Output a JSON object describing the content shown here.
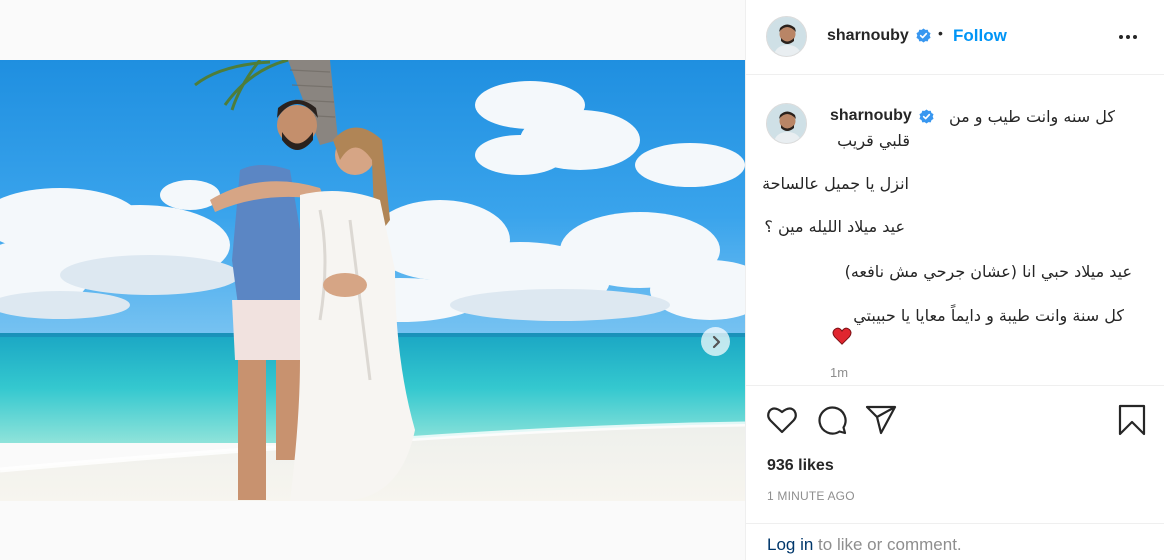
{
  "post": {
    "username": "sharnouby",
    "header_separator": "•",
    "follow_label": "Follow",
    "caption_lines": [
      "كل سنه وانت طيب و من",
      "قلبي قريب",
      "انزل يا جميل عالساحة",
      "عيد ميلاد الليله مين ؟",
      "عيد ميلاد حبي انا (عشان جرحي مش نافعه)",
      "كل سنة وانت طيبة و دايماً معايا يا حبيبتي"
    ],
    "caption_time": "1m",
    "likes": "936 likes",
    "post_time": "1 MINUTE AGO"
  },
  "footer": {
    "login_link": "Log in",
    "login_suffix": " to like or comment."
  },
  "colors": {
    "accent": "#0095f6",
    "verified": "#3897f0",
    "heart": "#e0262f"
  },
  "icons": [
    "verified-badge-icon",
    "more-options-icon",
    "heart-icon",
    "comment-icon",
    "share-icon",
    "bookmark-icon",
    "chevron-right-icon"
  ],
  "carousel": {
    "current_slide": 1,
    "total_slides": 2
  }
}
